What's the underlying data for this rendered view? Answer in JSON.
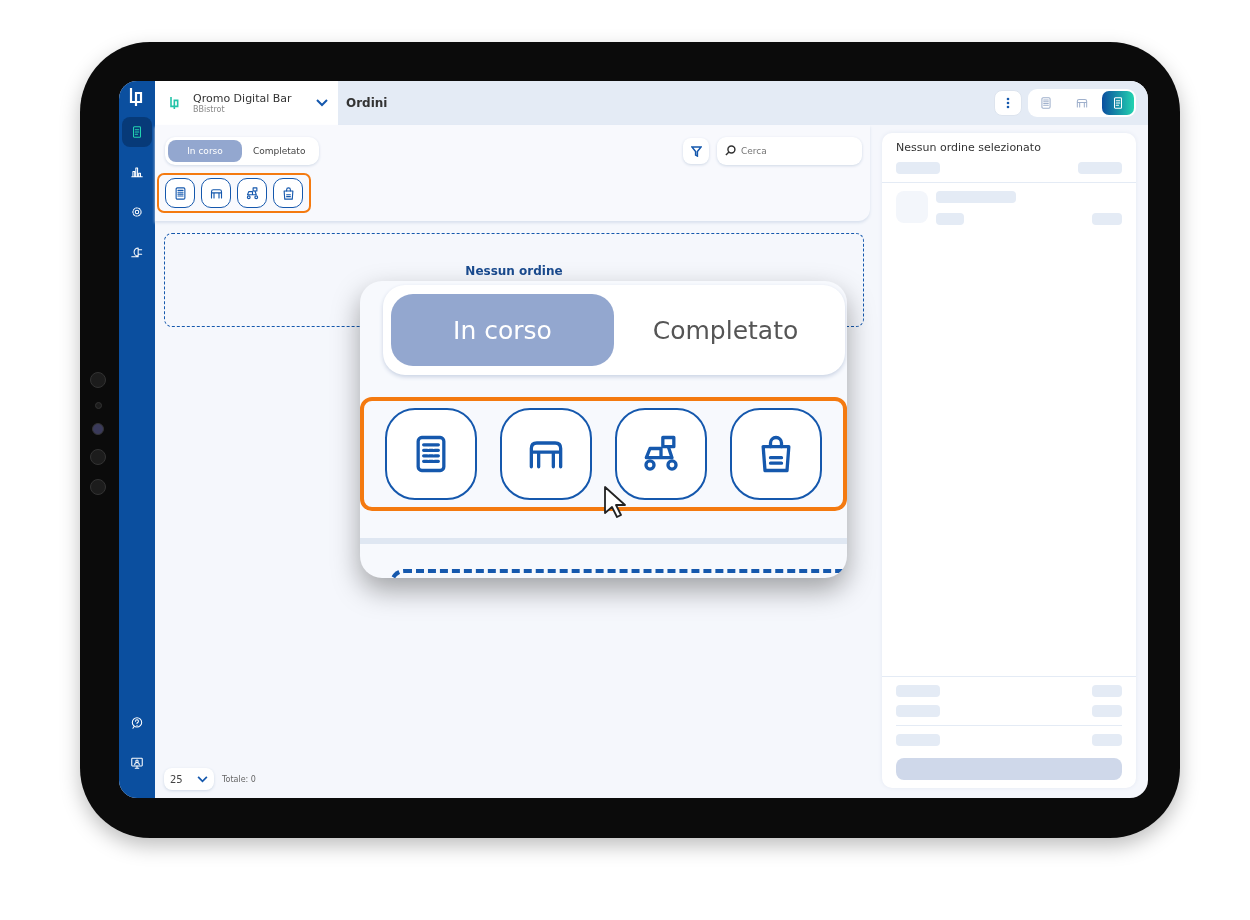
{
  "sidebar": {
    "items": [
      {
        "kind": "orders",
        "selected": true
      },
      {
        "kind": "stats",
        "selected": false
      },
      {
        "kind": "settings",
        "selected": false
      },
      {
        "kind": "plugin",
        "selected": false
      }
    ],
    "bottom_items": [
      {
        "kind": "help"
      },
      {
        "kind": "monitor"
      }
    ]
  },
  "header": {
    "venue": "Qromo Digital Bar",
    "subtitle": "BBistrot",
    "page_title": "Ordini",
    "view_switch": [
      {
        "kind": "kiosk",
        "selected": false
      },
      {
        "kind": "table",
        "selected": false
      },
      {
        "kind": "orders",
        "selected": true
      }
    ]
  },
  "tabs": [
    {
      "label": "In corso",
      "selected": true
    },
    {
      "label": "Completato",
      "selected": false
    }
  ],
  "service_filters": [
    {
      "kind": "kiosk"
    },
    {
      "kind": "table"
    },
    {
      "kind": "delivery"
    },
    {
      "kind": "takeaway"
    }
  ],
  "search": {
    "placeholder": "Cerca"
  },
  "empty_state": "Nessun ordine",
  "footer": {
    "page_size": "25",
    "total": "Totale: 0"
  },
  "detail_panel": {
    "title": "Nessun ordine selezionato"
  },
  "callout": {
    "tabs": [
      {
        "label": "In corso",
        "selected": true
      },
      {
        "label": "Completato",
        "selected": false
      }
    ],
    "service_filters": [
      {
        "kind": "kiosk"
      },
      {
        "kind": "table"
      },
      {
        "kind": "delivery"
      },
      {
        "kind": "takeaway"
      }
    ]
  }
}
